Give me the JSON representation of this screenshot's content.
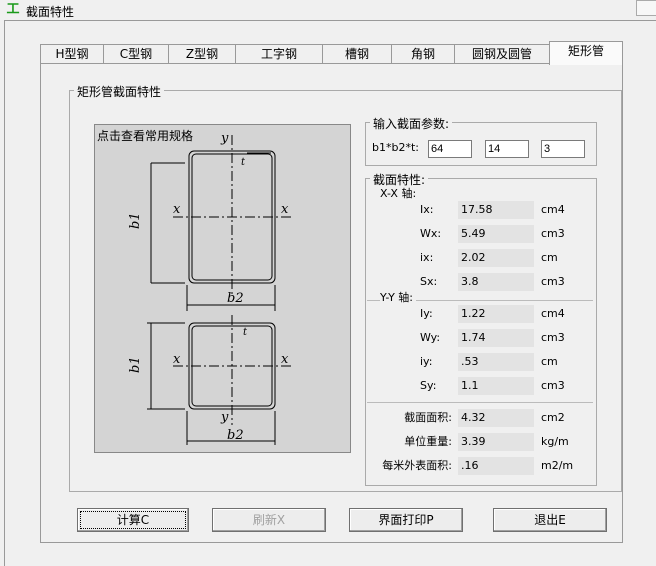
{
  "window": {
    "title": "截面特性",
    "icon": "steel-section-icon"
  },
  "tabs": [
    {
      "label": "H型钢"
    },
    {
      "label": "C型钢"
    },
    {
      "label": "Z型钢"
    },
    {
      "label": "工字钢"
    },
    {
      "label": "槽钢"
    },
    {
      "label": "角钢"
    },
    {
      "label": "圆钢及圆管"
    },
    {
      "label": "矩形管",
      "active": true
    }
  ],
  "panel": {
    "group_title": "矩形管截面特性",
    "diagram_link": "点击查看常用规格"
  },
  "diagram": {
    "y": "y",
    "x": "x",
    "b1": "b1",
    "b2": "b2",
    "t": "t"
  },
  "input": {
    "title": "输入截面参数:",
    "label": "b1*b2*t:",
    "b1": "64",
    "b2": "14",
    "t": "3"
  },
  "props": {
    "title": "截面特性:",
    "xx_title": "X-X 轴:",
    "yy_title": "Y-Y 轴:",
    "xx": [
      {
        "name": "Ix:",
        "value": "17.58",
        "unit": "cm4"
      },
      {
        "name": "Wx:",
        "value": "5.49",
        "unit": "cm3"
      },
      {
        "name": "ix:",
        "value": "2.02",
        "unit": "cm"
      },
      {
        "name": "Sx:",
        "value": "3.8",
        "unit": "cm3"
      }
    ],
    "yy": [
      {
        "name": "Iy:",
        "value": "1.22",
        "unit": "cm4"
      },
      {
        "name": "Wy:",
        "value": "1.74",
        "unit": "cm3"
      },
      {
        "name": "iy:",
        "value": ".53",
        "unit": "cm"
      },
      {
        "name": "Sy:",
        "value": "1.1",
        "unit": "cm3"
      }
    ],
    "other": [
      {
        "name": "截面面积:",
        "value": "4.32",
        "unit": "cm2"
      },
      {
        "name": "单位重量:",
        "value": "3.39",
        "unit": "kg/m"
      },
      {
        "name": "每米外表面积:",
        "value": ".16",
        "unit": "m2/m"
      }
    ]
  },
  "buttons": {
    "calc": "计算C",
    "refresh": "刷新X",
    "print": "界面打印P",
    "exit": "退出E"
  }
}
